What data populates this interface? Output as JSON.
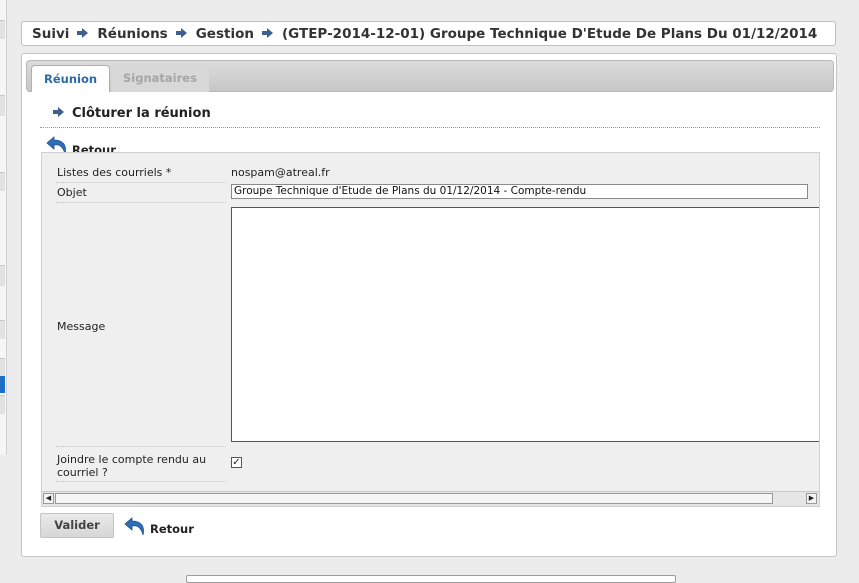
{
  "breadcrumb": [
    "Suivi",
    "Réunions",
    "Gestion",
    "(GTEP-2014-12-01) Groupe Technique D'Etude De Plans Du 01/12/2014"
  ],
  "tabs": [
    {
      "label": "Réunion",
      "active": true
    },
    {
      "label": "Signataires",
      "active": false
    }
  ],
  "section_title": "Clôturer la réunion",
  "back_label": "Retour",
  "form": {
    "mail_list_label": "Listes des courriels *",
    "mail_list_value": "nospam@atreal.fr",
    "subject_label": "Objet",
    "subject_value": "Groupe Technique d'Etude de Plans du 01/12/2014 - Compte-rendu",
    "message_label": "Message",
    "attach_label": "Joindre le compte rendu au courriel ?",
    "attach_checked": true
  },
  "submit_label": "Valider",
  "colors": {
    "accent_blue": "#2c6aa8",
    "arrow": "#3f5f8f"
  }
}
